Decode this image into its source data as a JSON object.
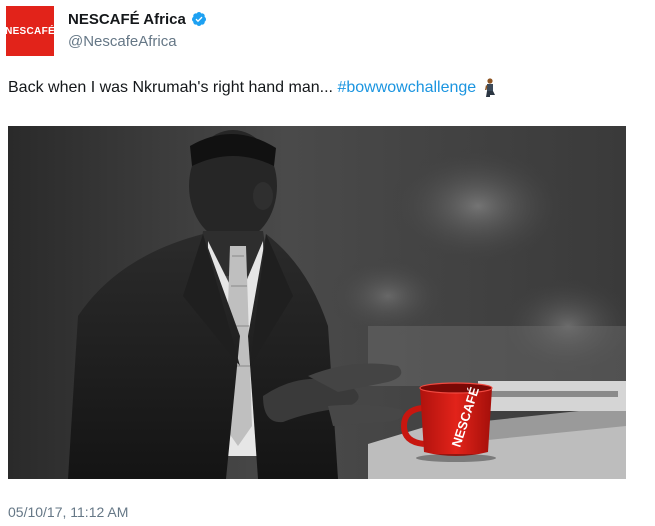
{
  "account": {
    "display_name": "NESCAFÉ Africa",
    "handle": "@NescafeAfrica",
    "avatar_text": "NESCAFÉ",
    "verified": true
  },
  "tweet": {
    "text": "Back when I was Nkrumah's right hand man...",
    "hashtag": "#bowwowchallenge",
    "emoji": "person-kneeling-emoji",
    "timestamp": "05/10/17, 11:12 AM"
  },
  "photo": {
    "mug_brand_text": "NESCAFÉ"
  },
  "colors": {
    "brand_red": "#e2231a",
    "link_blue": "#1b95e0",
    "secondary_text": "#657786",
    "verified_blue": "#1da1f2"
  }
}
